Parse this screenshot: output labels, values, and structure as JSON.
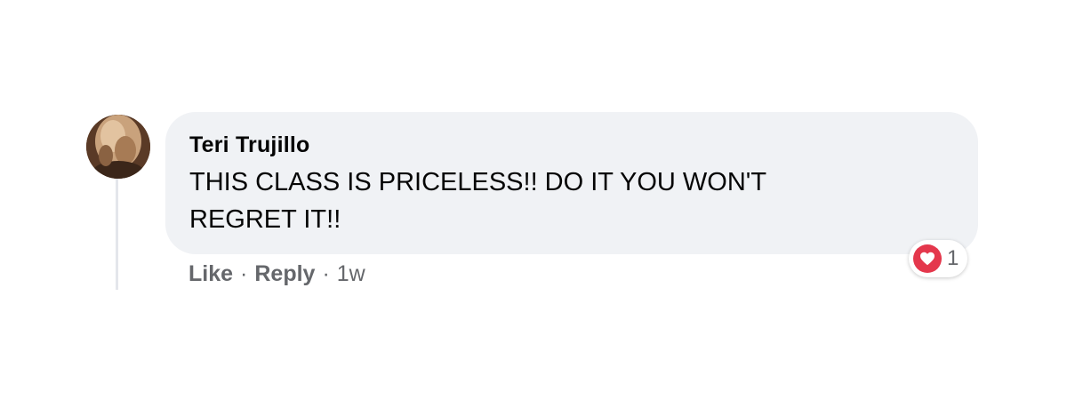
{
  "comment": {
    "author": "Teri Trujillo",
    "text": "THIS CLASS IS PRICELESS!! DO IT YOU WON'T REGRET IT!!",
    "actions": {
      "like": "Like",
      "reply": "Reply",
      "separator": "·",
      "timestamp": "1w"
    },
    "reaction": {
      "icon": "heart-icon",
      "count": "1",
      "color": "#e4374c"
    }
  },
  "colors": {
    "bubble_bg": "#f0f2f5",
    "text": "#050505",
    "secondary_text": "#65676b"
  }
}
